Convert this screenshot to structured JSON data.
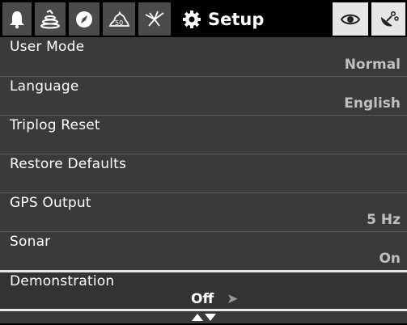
{
  "tabs": [
    {
      "icon": "bell-icon"
    },
    {
      "icon": "layers-icon"
    },
    {
      "icon": "compass-icon"
    },
    {
      "icon": "map-icon"
    },
    {
      "icon": "radar-icon"
    },
    {
      "icon": "gear-icon",
      "label": "Setup",
      "active": true
    },
    {
      "icon": "eye-icon"
    },
    {
      "icon": "satellite-icon"
    }
  ],
  "menu": {
    "items": [
      {
        "label": "User Mode",
        "value": "Normal"
      },
      {
        "label": "Language",
        "value": "English"
      },
      {
        "label": "Triplog Reset",
        "value": ""
      },
      {
        "label": "Restore Defaults",
        "value": ""
      },
      {
        "label": "GPS Output",
        "value": "5 Hz"
      },
      {
        "label": "Sonar",
        "value": "On"
      },
      {
        "label": "Demonstration",
        "value": "Off",
        "selected": true
      }
    ]
  },
  "footer": {
    "icon": "up-down-arrows-icon"
  },
  "colors": {
    "background": "#3a3a3a",
    "tab": "#4b4b4b",
    "highlight": "#e6e6e6",
    "value_text": "#bfbfbf"
  }
}
